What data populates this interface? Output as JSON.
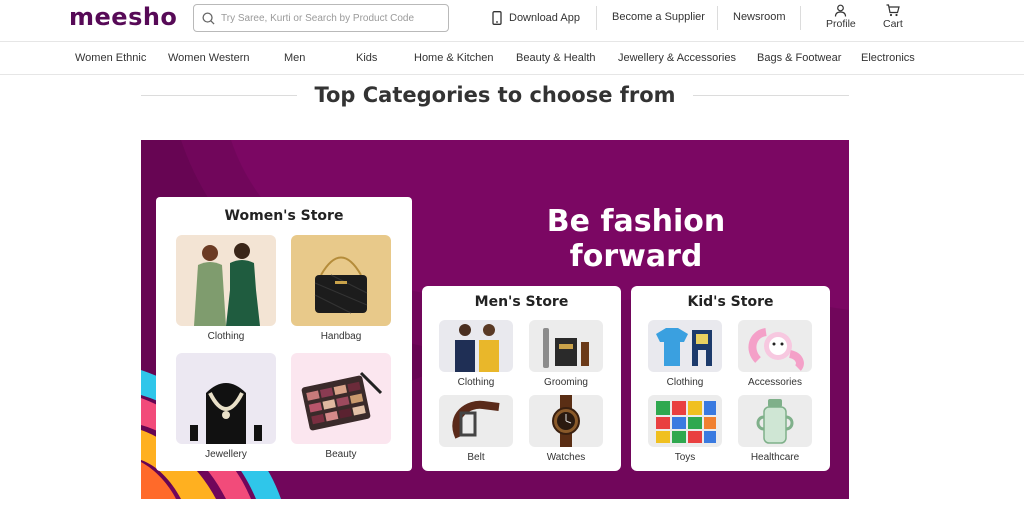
{
  "header": {
    "logo": "meesho",
    "search_placeholder": "Try Saree, Kurti or Search by Product Code",
    "download_app": "Download App",
    "become_supplier": "Become a Supplier",
    "newsroom": "Newsroom",
    "profile": "Profile",
    "cart": "Cart",
    "brand_color": "#570a57"
  },
  "categories": [
    "Women Ethnic",
    "Women Western",
    "Men",
    "Kids",
    "Home & Kitchen",
    "Beauty & Health",
    "Jewellery & Accessories",
    "Bags & Footwear",
    "Electronics"
  ],
  "section_title": "Top Categories to choose from",
  "banner": {
    "headline": "Be fashion forward",
    "bg_color": "#7b0763",
    "womens_store": {
      "title": "Women's Store",
      "items": [
        {
          "label": "Clothing",
          "icon": "clothing-photo-icon"
        },
        {
          "label": "Handbag",
          "icon": "handbag-photo-icon"
        },
        {
          "label": "Jewellery",
          "icon": "necklace-photo-icon"
        },
        {
          "label": "Beauty",
          "icon": "eyeshadow-palette-photo-icon"
        }
      ]
    },
    "mens_store": {
      "title": "Men's Store",
      "items": [
        {
          "label": "Clothing",
          "icon": "mens-clothing-photo-icon"
        },
        {
          "label": "Grooming",
          "icon": "grooming-kit-photo-icon"
        },
        {
          "label": "Belt",
          "icon": "belt-photo-icon"
        },
        {
          "label": "Watches",
          "icon": "watch-photo-icon"
        }
      ]
    },
    "kids_store": {
      "title": "Kid's Store",
      "items": [
        {
          "label": "Clothing",
          "icon": "kids-clothing-photo-icon"
        },
        {
          "label": "Accessories",
          "icon": "kids-watch-photo-icon"
        },
        {
          "label": "Toys",
          "icon": "toy-blocks-photo-icon"
        },
        {
          "label": "Healthcare",
          "icon": "sipper-bottle-photo-icon"
        }
      ]
    }
  }
}
